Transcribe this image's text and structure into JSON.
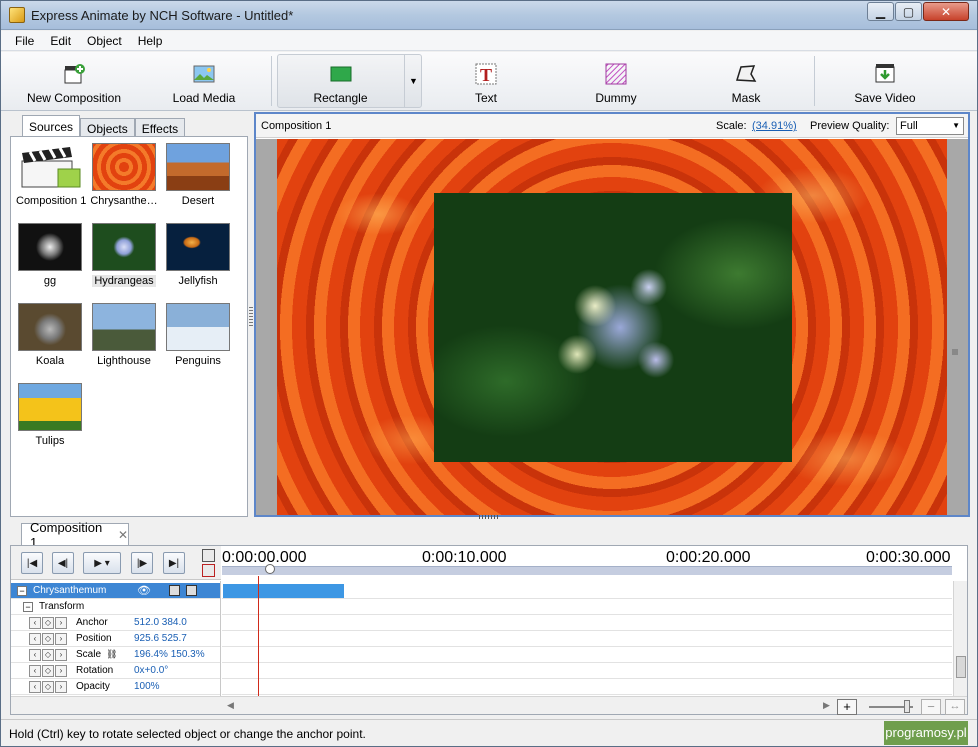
{
  "window": {
    "title": "Express Animate by NCH Software - Untitled*"
  },
  "menu": [
    "File",
    "Edit",
    "Object",
    "Help"
  ],
  "toolbar": {
    "new_composition": "New Composition",
    "load_media": "Load Media",
    "rectangle": "Rectangle",
    "text": "Text",
    "dummy": "Dummy",
    "mask": "Mask",
    "save_video": "Save Video"
  },
  "left_tabs": [
    "Sources",
    "Objects",
    "Effects"
  ],
  "sources": [
    {
      "label": "Composition 1",
      "icon": "clapperboard-icon"
    },
    {
      "label": "Chrysanthe…",
      "icon": "image-thumbnail"
    },
    {
      "label": "Desert",
      "icon": "image-thumbnail"
    },
    {
      "label": "gg",
      "icon": "image-thumbnail"
    },
    {
      "label": "Hydrangeas",
      "icon": "image-thumbnail"
    },
    {
      "label": "Jellyfish",
      "icon": "image-thumbnail"
    },
    {
      "label": "Koala",
      "icon": "image-thumbnail"
    },
    {
      "label": "Lighthouse",
      "icon": "image-thumbnail"
    },
    {
      "label": "Penguins",
      "icon": "image-thumbnail"
    },
    {
      "label": "Tulips",
      "icon": "image-thumbnail"
    }
  ],
  "preview": {
    "composition": "Composition 1",
    "scale_label": "Scale:",
    "scale_value": "(34.91%)",
    "quality_label": "Preview Quality:",
    "quality_value": "Full"
  },
  "timeline": {
    "tab": "Composition 1",
    "ruler": [
      "0:00:00.000",
      "0:00:10.000",
      "0:00:20.000",
      "0:00:30.000"
    ],
    "track_name": "Chrysanthemum",
    "group": "Transform",
    "properties": [
      {
        "name": "Anchor",
        "value": "512.0  384.0"
      },
      {
        "name": "Position",
        "value": "925.6  525.7"
      },
      {
        "name": "Scale",
        "value": "196.4%  150.3%"
      },
      {
        "name": "Rotation",
        "value": "0x+0.0°"
      },
      {
        "name": "Opacity",
        "value": "100%"
      }
    ]
  },
  "status": {
    "text": "Hold (Ctrl) key to rotate selected object or change the anchor point.",
    "watermark": "programosy.pl"
  },
  "colors": {
    "selection": "#3d86d4",
    "accent": "#1a5fb4",
    "playhead": "#d02a1a"
  }
}
